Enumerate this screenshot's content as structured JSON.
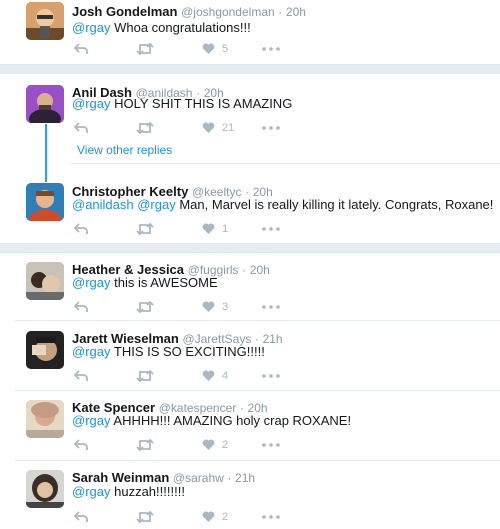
{
  "tweets": [
    {
      "name": "Josh Gondelman",
      "handle": "@joshgondelman",
      "dot": "·",
      "time": "20h",
      "mention": "@rgay",
      "body": " Whoa congratulations!!!",
      "likes": "5",
      "avatar": "avatar-josh"
    },
    {
      "name": "Anil Dash",
      "handle": "@anildash",
      "dot": "·",
      "time": "20h",
      "mention": "@rgay",
      "body": " HOLY SHIT THIS IS AMAZING",
      "likes": "21",
      "avatar": "avatar-anil"
    },
    {
      "name": "Christopher Keelty",
      "handle": "@keeltyc",
      "dot": "·",
      "time": "20h",
      "mention": "@anildash @rgay",
      "body": " Man, Marvel is really killing it lately. Congrats, Roxane!",
      "likes": "1",
      "avatar": "avatar-chris"
    },
    {
      "name": "Heather & Jessica",
      "handle": "@fuggirls",
      "dot": "·",
      "time": "20h",
      "mention": "@rgay",
      "body": " this is AWESOME",
      "likes": "3",
      "avatar": "avatar-heather"
    },
    {
      "name": "Jarett Wieselman",
      "handle": "@JarettSays",
      "dot": "·",
      "time": "21h",
      "mention": "@rgay",
      "body": " THIS IS SO EXCITING!!!!!",
      "likes": "4",
      "avatar": "avatar-jarett"
    },
    {
      "name": "Kate Spencer",
      "handle": "@katespencer",
      "dot": "·",
      "time": "20h",
      "mention": "@rgay",
      "body": " AHHHH!!! AMAZING holy crap ROXANE!",
      "likes": "2",
      "avatar": "avatar-kate"
    },
    {
      "name": "Sarah Weinman",
      "handle": "@sarahw",
      "dot": "·",
      "time": "21h",
      "mention": "@rgay",
      "body": " huzzah!!!!!!!!",
      "likes": "2",
      "avatar": "avatar-sarah"
    }
  ],
  "view_other_replies": "View other replies",
  "icons": {
    "reply": "reply-icon",
    "retweet": "retweet-icon",
    "like": "heart-icon",
    "more": "more-icon"
  },
  "colors": {
    "link": "#1b95e0",
    "meta": "#8899a6",
    "action": "#aab8c2",
    "thread": "#1da1f2"
  }
}
